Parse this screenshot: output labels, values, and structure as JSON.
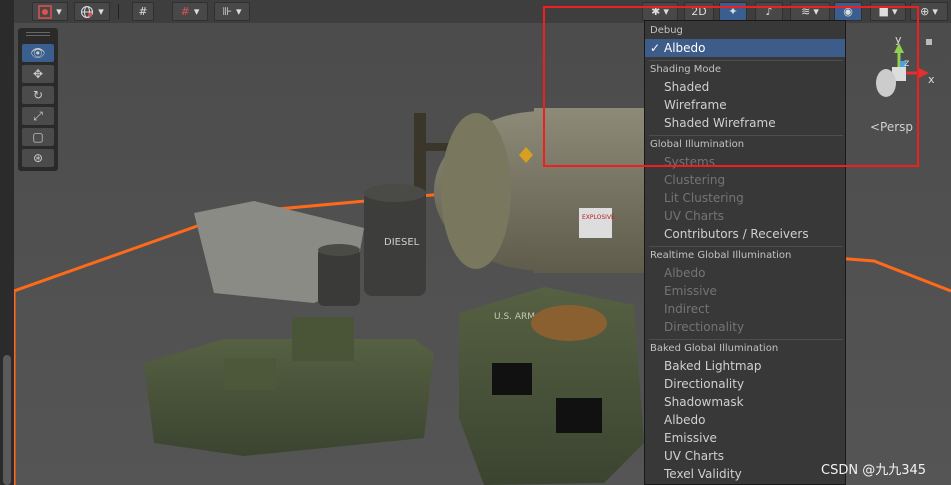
{
  "toolbar": {
    "mode_2d_label": "2D",
    "icons": [
      "gizmo-color-icon",
      "globe-icon",
      "grid-snap-icon",
      "grid-icon",
      "ruler-icon",
      "debug-draw-icon",
      "light-icon",
      "audio-icon",
      "effects-icon",
      "visibility-icon",
      "camera-icon",
      "gizmo-icon"
    ]
  },
  "tools": [
    "view-tool-icon",
    "move-tool-icon",
    "rotate-tool-icon",
    "scale-tool-icon",
    "rect-tool-icon",
    "transform-tool-icon"
  ],
  "gizmo": {
    "axis_y": "y",
    "axis_z": "z",
    "axis_x": "x",
    "persp_label": "<Persp"
  },
  "menu": {
    "debug_header": "Debug",
    "albedo_selected": "Albedo",
    "shading_header": "Shading Mode",
    "shading_items": [
      "Shaded",
      "Wireframe",
      "Shaded Wireframe"
    ],
    "gi_header": "Global Illumination",
    "gi_items": [
      "Systems",
      "Clustering",
      "Lit Clustering",
      "UV Charts",
      "Contributors / Receivers"
    ],
    "realtime_header": "Realtime Global Illumination",
    "realtime_items": [
      "Albedo",
      "Emissive",
      "Indirect",
      "Directionality"
    ],
    "baked_header": "Baked Global Illumination",
    "baked_items": [
      "Baked Lightmap",
      "Directionality",
      "Shadowmask",
      "Albedo",
      "Emissive",
      "UV Charts",
      "Texel Validity"
    ]
  },
  "scene": {
    "crate_label": "U.S. ARM",
    "barrel_label": "DIESEL",
    "sign_label": "EXPLOSIVE"
  },
  "watermark": "CSDN @九九345",
  "colors": {
    "selection": "#3d5c8a",
    "highlight_box": "#f01e1e",
    "boundary_line": "#ff6a1a"
  }
}
